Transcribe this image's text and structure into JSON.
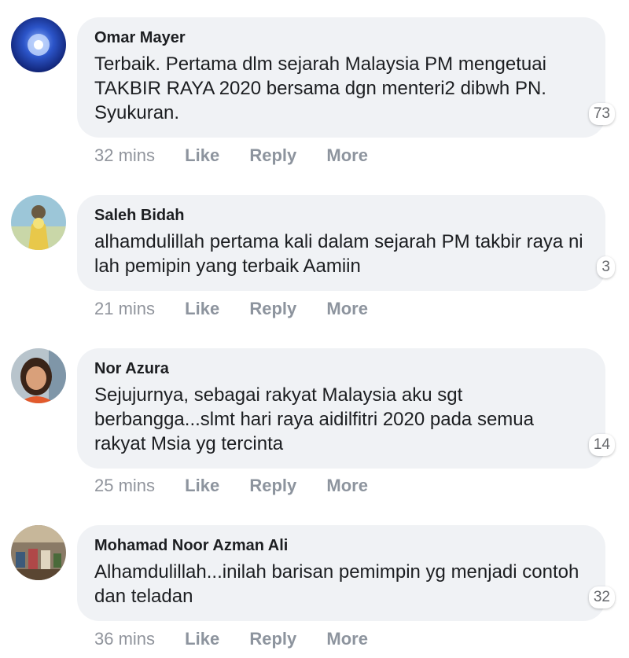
{
  "comments": [
    {
      "author": "Omar Mayer",
      "text": "Terbaik. Pertama dlm sejarah Malaysia PM mengetuai TAKBIR RAYA 2020 bersama dgn menteri2 dibwh PN. Syukuran.",
      "reactions": "73",
      "time": "32 mins",
      "like": "Like",
      "reply": "Reply",
      "more": "More"
    },
    {
      "author": "Saleh Bidah",
      "text": "alhamdulillah pertama kali dalam sejarah PM takbir raya ni lah pemipin yang terbaik Aamiin",
      "reactions": "3",
      "time": "21 mins",
      "like": "Like",
      "reply": "Reply",
      "more": "More"
    },
    {
      "author": "Nor Azura",
      "text": "Sejujurnya, sebagai rakyat Malaysia aku sgt berbangga...slmt hari raya aidilfitri 2020 pada semua rakyat Msia yg tercinta",
      "reactions": "14",
      "time": "25 mins",
      "like": "Like",
      "reply": "Reply",
      "more": "More"
    },
    {
      "author": "Mohamad Noor Azman Ali",
      "text": "Alhamdulillah...inilah barisan pemimpin yg menjadi contoh dan teladan",
      "reactions": "32",
      "time": "36 mins",
      "like": "Like",
      "reply": "Reply",
      "more": "More"
    }
  ],
  "colors": {
    "bubble": "#f0f2f5",
    "name": "#1c1e21",
    "meta": "#90949c",
    "action": "#8d949e"
  }
}
